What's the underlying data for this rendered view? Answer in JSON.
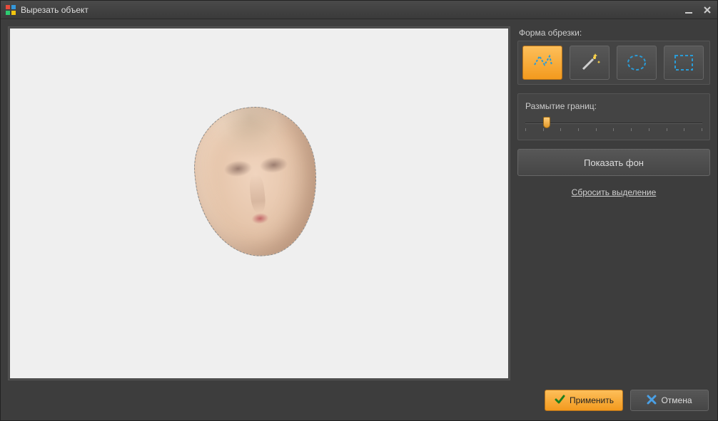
{
  "window": {
    "title": "Вырезать объект"
  },
  "sidebar": {
    "crop_shape_label": "Форма обрезки:",
    "blur_edges_label": "Размытие границ:",
    "blur_value_percent": 10,
    "show_background_label": "Показать фон",
    "reset_selection_label": "Сбросить выделение",
    "shapes": [
      {
        "name": "free-shape",
        "active": true
      },
      {
        "name": "magic-wand",
        "active": false
      },
      {
        "name": "ellipse",
        "active": false
      },
      {
        "name": "rectangle",
        "active": false
      }
    ]
  },
  "footer": {
    "apply_label": "Применить",
    "cancel_label": "Отмена"
  }
}
